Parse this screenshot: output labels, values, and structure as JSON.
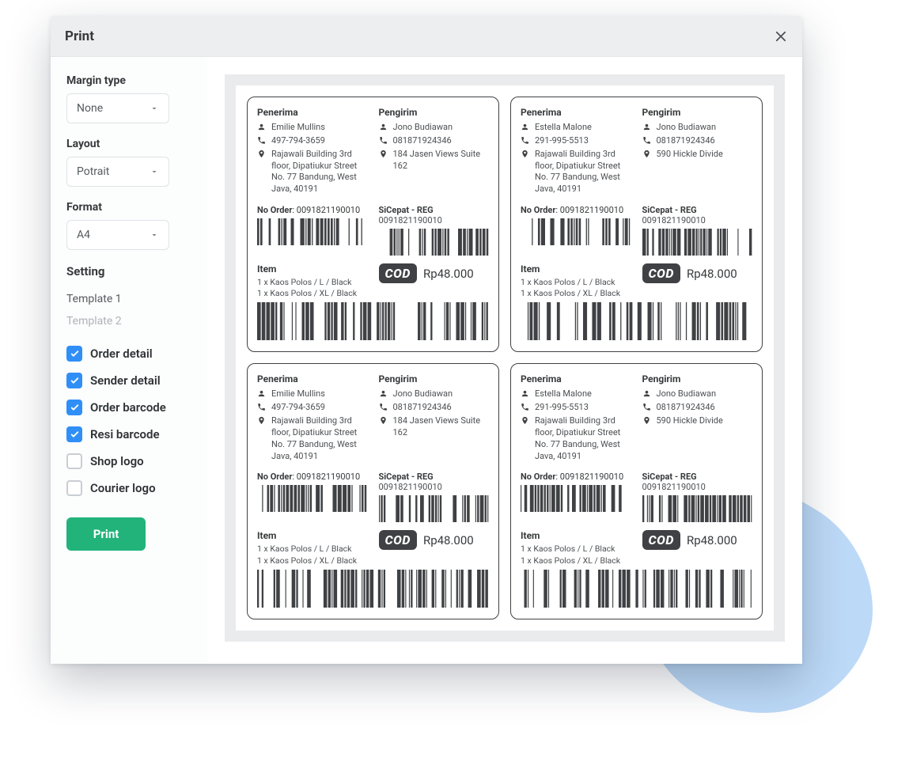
{
  "dialog": {
    "title": "Print"
  },
  "sidebar": {
    "margin": {
      "label": "Margin type",
      "value": "None"
    },
    "layout": {
      "label": "Layout",
      "value": "Potrait"
    },
    "format": {
      "label": "Format",
      "value": "A4"
    },
    "setting_label": "Setting",
    "templates": [
      "Template 1",
      "Template 2"
    ],
    "options": [
      {
        "label": "Order detail",
        "checked": true
      },
      {
        "label": "Sender detail",
        "checked": true
      },
      {
        "label": "Order barcode",
        "checked": true
      },
      {
        "label": "Resi barcode",
        "checked": true
      },
      {
        "label": "Shop logo",
        "checked": false
      },
      {
        "label": "Courier logo",
        "checked": false
      }
    ],
    "print_button": "Print"
  },
  "label_strings": {
    "recipient": "Penerima",
    "sender": "Pengirim",
    "no_order": "No Order",
    "item": "Item",
    "cod": "COD"
  },
  "sender": {
    "name": "Jono Budiawan",
    "phone": "081871924346"
  },
  "labels": [
    {
      "recipient": {
        "name": "Emilie Mullins",
        "phone": "497-794-3659",
        "address": "Rajawali Building 3rd floor, Dipatiukur Street No. 77 Bandung, West Java, 40191"
      },
      "sender_address": "184 Jasen Views Suite 162",
      "order_no": "0091821190010",
      "ship_service": "SiCepat - REG",
      "awb": "0091821190010",
      "items": [
        "1 x Kaos Polos / L / Black",
        "1 x Kaos Polos / XL / Black"
      ],
      "cod_amount": "Rp48.000"
    },
    {
      "recipient": {
        "name": "Estella Malone",
        "phone": "291-995-5513",
        "address": "Rajawali Building 3rd floor, Dipatiukur Street No. 77 Bandung, West Java, 40191"
      },
      "sender_address": "590 Hickle Divide",
      "order_no": "0091821190010",
      "ship_service": "SiCepat - REG",
      "awb": "0091821190010",
      "items": [
        "1 x Kaos Polos / L / Black",
        "1 x Kaos Polos / XL / Black"
      ],
      "cod_amount": "Rp48.000"
    },
    {
      "recipient": {
        "name": "Emilie Mullins",
        "phone": "497-794-3659",
        "address": "Rajawali Building 3rd floor, Dipatiukur Street No. 77 Bandung, West Java, 40191"
      },
      "sender_address": "184 Jasen Views Suite 162",
      "order_no": "0091821190010",
      "ship_service": "SiCepat - REG",
      "awb": "0091821190010",
      "items": [
        "1 x Kaos Polos / L / Black",
        "1 x Kaos Polos / XL / Black"
      ],
      "cod_amount": "Rp48.000"
    },
    {
      "recipient": {
        "name": "Estella Malone",
        "phone": "291-995-5513",
        "address": "Rajawali Building 3rd floor, Dipatiukur Street No. 77 Bandung, West Java, 40191"
      },
      "sender_address": "590 Hickle Divide",
      "order_no": "0091821190010",
      "ship_service": "SiCepat - REG",
      "awb": "0091821190010",
      "items": [
        "1 x Kaos Polos / L / Black",
        "1 x Kaos Polos / XL / Black"
      ],
      "cod_amount": "Rp48.000"
    }
  ]
}
